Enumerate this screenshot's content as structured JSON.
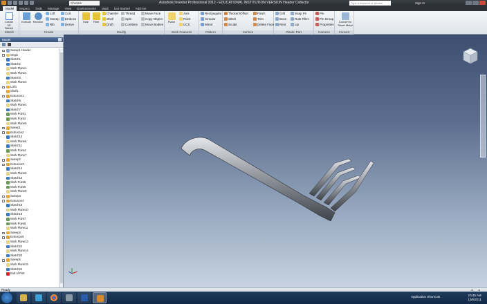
{
  "window": {
    "title": "Autodesk Inventor Professional 2012 - EDUCATIONAL INSTITUTION VERSION   Header Collector",
    "material": "Chrome",
    "search_placeholder": "Type a keyword or phrase",
    "signin": "Sign In"
  },
  "menu_tabs": [
    "Model",
    "Inspect",
    "Tools",
    "Manage",
    "View",
    "Environments",
    "Vault",
    "Get Started",
    "Add-Ins"
  ],
  "ribbon": {
    "sketch": {
      "title": "Sketch",
      "create_label": "Create 2D Sketch"
    },
    "create": {
      "title": "Create",
      "extrude": "Extrude",
      "revolve": "Revolve",
      "loft": "Loft",
      "sweep": "Sweep",
      "rib": "Rib",
      "coil": "Coil",
      "emboss": "Emboss",
      "derive": "Derive"
    },
    "modify": {
      "title": "Modify",
      "hole": "Hole",
      "fillet": "Fillet",
      "chamfer": "Chamfer",
      "shell": "Shell",
      "draft": "Draft",
      "thread": "Thread",
      "split": "Split",
      "combine": "Combine",
      "move_face": "Move Face",
      "copy_object": "Copy Object",
      "move_bodies": "Move Bodies"
    },
    "work_features": {
      "title": "Work Features",
      "plane": "Plane",
      "axis": "Axis",
      "point": "Point",
      "ucs": "UCS"
    },
    "pattern": {
      "title": "Pattern",
      "rectangular": "Rectangular",
      "circular": "Circular",
      "mirror": "Mirror"
    },
    "surface": {
      "title": "Surface",
      "thicken": "Thicken/Offset",
      "stitch": "Stitch",
      "sculpt": "Sculpt",
      "patch": "Patch",
      "trim": "Trim",
      "delete_face": "Delete Face"
    },
    "plastic_part": {
      "title": "Plastic Part",
      "grill": "Grill",
      "boss": "Boss",
      "rest": "Rest",
      "snap_fit": "Snap Fit",
      "rule_fillet": "Rule Fillet",
      "lip": "Lip"
    },
    "harness": {
      "title": "Harness",
      "pin": "Pin",
      "pin_group": "Pin Group",
      "properties": "Properties"
    },
    "convert": {
      "title": "Convert",
      "sheet_metal": "Convert to Sheet Metal"
    }
  },
  "browser": {
    "header": "Model",
    "items": [
      {
        "label": "Sweep1 Header",
        "icon": "part",
        "plus": true
      },
      {
        "label": "Origin",
        "icon": "folder",
        "plus": true
      },
      {
        "label": "Sketch1",
        "icon": "sketch",
        "plus": false
      },
      {
        "label": "Sketch2",
        "icon": "sketch",
        "plus": false
      },
      {
        "label": "Work Plane1",
        "icon": "plane",
        "plus": false
      },
      {
        "label": "Work Plane2",
        "icon": "plane",
        "plus": false
      },
      {
        "label": "Sketch3",
        "icon": "sketch",
        "plus": false
      },
      {
        "label": "Work Plane3",
        "icon": "plane",
        "plus": false
      },
      {
        "label": "Loft1",
        "icon": "feature",
        "plus": true
      },
      {
        "label": "Shell1",
        "icon": "feature",
        "plus": false
      },
      {
        "label": "Extrusion1",
        "icon": "extrude",
        "plus": true
      },
      {
        "label": "Sketch6",
        "icon": "sketch",
        "plus": false
      },
      {
        "label": "Work Plane4",
        "icon": "plane",
        "plus": false
      },
      {
        "label": "Sketch7",
        "icon": "sketch",
        "plus": false
      },
      {
        "label": "Work Point1",
        "icon": "point",
        "plus": false
      },
      {
        "label": "Work Point2",
        "icon": "point",
        "plus": false
      },
      {
        "label": "Work Plane5",
        "icon": "plane",
        "plus": false
      },
      {
        "label": "Sweep1",
        "icon": "feature",
        "plus": true
      },
      {
        "label": "Extrusion2",
        "icon": "extrude",
        "plus": true
      },
      {
        "label": "Sketch10",
        "icon": "sketch",
        "plus": false
      },
      {
        "label": "Work Plane6",
        "icon": "plane",
        "plus": false
      },
      {
        "label": "Sketch11",
        "icon": "sketch",
        "plus": false
      },
      {
        "label": "Work Point4",
        "icon": "point",
        "plus": false
      },
      {
        "label": "Work Plane7",
        "icon": "plane",
        "plus": false
      },
      {
        "label": "Sweep2",
        "icon": "feature",
        "plus": true
      },
      {
        "label": "Extrusion3",
        "icon": "extrude",
        "plus": true
      },
      {
        "label": "Sketch14",
        "icon": "sketch",
        "plus": false
      },
      {
        "label": "Work Plane8",
        "icon": "plane",
        "plus": false
      },
      {
        "label": "Sketch15",
        "icon": "sketch",
        "plus": false
      },
      {
        "label": "Work Point5",
        "icon": "point",
        "plus": false
      },
      {
        "label": "Work Point6",
        "icon": "point",
        "plus": false
      },
      {
        "label": "Work Plane9",
        "icon": "plane",
        "plus": false
      },
      {
        "label": "Sweep3",
        "icon": "feature",
        "plus": true
      },
      {
        "label": "Extrusion4",
        "icon": "extrude",
        "plus": true
      },
      {
        "label": "Sketch18",
        "icon": "sketch",
        "plus": false
      },
      {
        "label": "Work Plane10",
        "icon": "plane",
        "plus": false
      },
      {
        "label": "Sketch19",
        "icon": "sketch",
        "plus": false
      },
      {
        "label": "Work Point7",
        "icon": "point",
        "plus": false
      },
      {
        "label": "Work Point8",
        "icon": "point",
        "plus": false
      },
      {
        "label": "Work Plane11",
        "icon": "plane",
        "plus": false
      },
      {
        "label": "Sweep4",
        "icon": "feature",
        "plus": true
      },
      {
        "label": "Extrusion5",
        "icon": "extrude",
        "plus": true
      },
      {
        "label": "Work Plane13",
        "icon": "plane",
        "plus": false
      },
      {
        "label": "Sketch22",
        "icon": "sketch",
        "plus": false
      },
      {
        "label": "Work Plane14",
        "icon": "plane",
        "plus": false
      },
      {
        "label": "Sketch23",
        "icon": "sketch",
        "plus": false
      },
      {
        "label": "Sweep5",
        "icon": "feature",
        "plus": true
      },
      {
        "label": "Work Plane15",
        "icon": "plane",
        "plus": false
      },
      {
        "label": "Sketch24",
        "icon": "sketch",
        "plus": false
      },
      {
        "label": "End of Part",
        "icon": "end",
        "plus": false
      }
    ]
  },
  "status": {
    "text": "Ready",
    "n1": "1",
    "n2": "1"
  },
  "taskbar": {
    "shortcuts": "Application Shortcuts",
    "time": "10:45 AM",
    "date": "10/6/2011"
  },
  "colors": {
    "accent": "#3d5a80",
    "sketch_icon": "#3b78c4",
    "feature_icon": "#e8a93a",
    "plane_icon": "#e6d48a",
    "point_icon": "#6a9b56",
    "end_icon": "#cc2a2a"
  }
}
